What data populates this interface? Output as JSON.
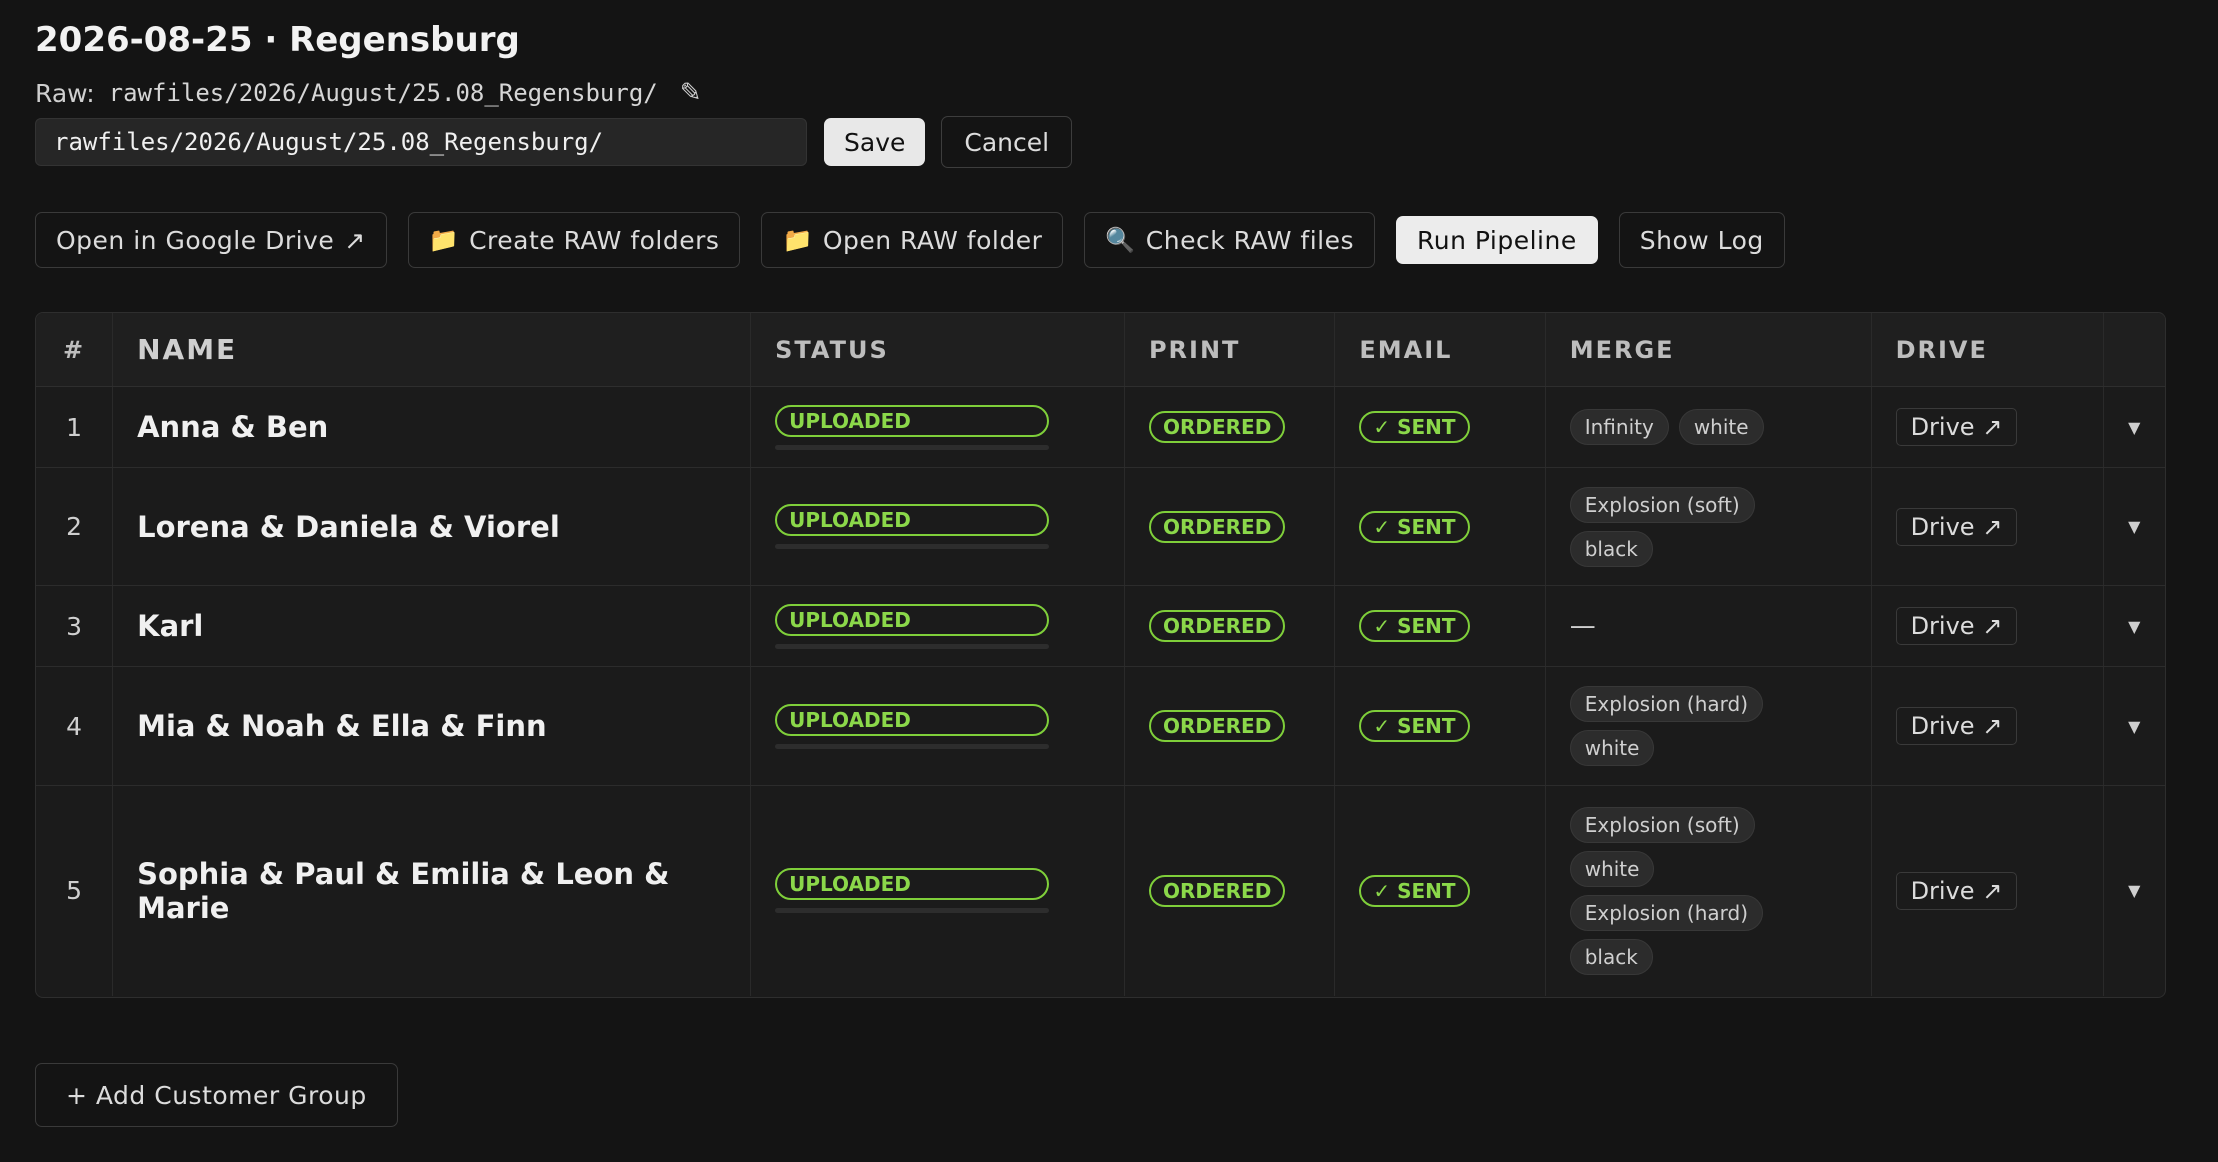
{
  "header": {
    "title": "2026-08-25 · Regensburg",
    "raw_label": "Raw:",
    "raw_path": "rawfiles/2026/August/25.08_Regensburg/",
    "edit_icon": "pencil-icon"
  },
  "edit": {
    "input_value": "rawfiles/2026/August/25.08_Regensburg/",
    "save_label": "Save",
    "cancel_label": "Cancel"
  },
  "toolbar": {
    "open_drive": "Open in Google Drive",
    "open_drive_arrow": "↗",
    "create_raw": "Create RAW folders",
    "open_raw": "Open RAW folder",
    "check_raw": "Check RAW files",
    "run_pipeline": "Run Pipeline",
    "show_log": "Show Log"
  },
  "table": {
    "headers": {
      "num": "#",
      "name": "NAME",
      "status": "STATUS",
      "print": "PRINT",
      "email": "EMAIL",
      "merge": "MERGE",
      "drive": "DRIVE"
    },
    "rows": [
      {
        "num": "1",
        "name": "Anna & Ben",
        "status": "UPLOADED",
        "print": "ORDERED",
        "email": "✓ SENT",
        "merge": [
          "Infinity",
          "white"
        ],
        "drive": "Drive ↗"
      },
      {
        "num": "2",
        "name": "Lorena & Daniela & Viorel",
        "status": "UPLOADED",
        "print": "ORDERED",
        "email": "✓ SENT",
        "merge": [
          "Explosion (soft)",
          "black"
        ],
        "drive": "Drive ↗"
      },
      {
        "num": "3",
        "name": "Karl",
        "status": "UPLOADED",
        "print": "ORDERED",
        "email": "✓ SENT",
        "merge_empty": "—",
        "drive": "Drive ↗"
      },
      {
        "num": "4",
        "name": "Mia & Noah & Ella & Finn",
        "status": "UPLOADED",
        "print": "ORDERED",
        "email": "✓ SENT",
        "merge": [
          "Explosion (hard)",
          "white"
        ],
        "drive": "Drive ↗"
      },
      {
        "num": "5",
        "name": "Sophia & Paul & Emilia & Leon & Marie",
        "status": "UPLOADED",
        "print": "ORDERED",
        "email": "✓ SENT",
        "merge": [
          "Explosion (soft)",
          "white",
          "Explosion (hard)",
          "black"
        ],
        "drive": "Drive ↗"
      }
    ]
  },
  "footer": {
    "add_group": "+ Add Customer Group"
  },
  "colors": {
    "background": "#141414",
    "accent_green": "#8bd84a"
  }
}
